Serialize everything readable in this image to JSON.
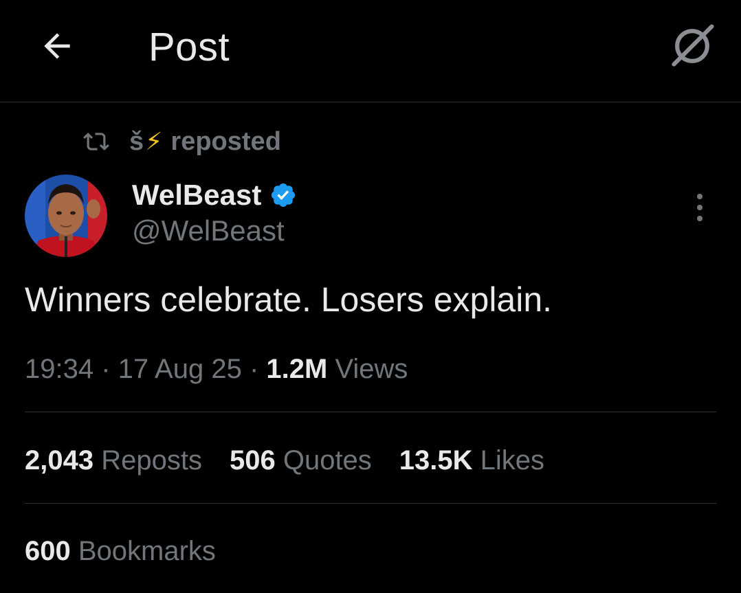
{
  "header": {
    "title": "Post",
    "back_icon": "arrow-left-icon",
    "grok_icon": "grok-icon"
  },
  "repost_context": {
    "icon": "repost-icon",
    "reposter_name": "š",
    "reposter_emoji": "⚡",
    "label": "reposted"
  },
  "author": {
    "name": "WelBeast",
    "handle": "@WelBeast",
    "verified": true,
    "verified_color": "#1d9bf0"
  },
  "post": {
    "text": "Winners celebrate. Losers explain."
  },
  "meta": {
    "time": "19:34",
    "sep1": " · ",
    "date": "17 Aug 25",
    "sep2": " · ",
    "views_count": "1.2M",
    "views_label": " Views"
  },
  "stats": {
    "reposts_count": "2,043",
    "reposts_label": " Reposts",
    "quotes_count": "506",
    "quotes_label": " Quotes",
    "likes_count": "13.5K",
    "likes_label": " Likes",
    "bookmarks_count": "600",
    "bookmarks_label": " Bookmarks"
  },
  "colors": {
    "background": "#000000",
    "text_primary": "#e7e9ea",
    "text_secondary": "#71767b",
    "divider": "#2f3336",
    "accent": "#1d9bf0"
  }
}
